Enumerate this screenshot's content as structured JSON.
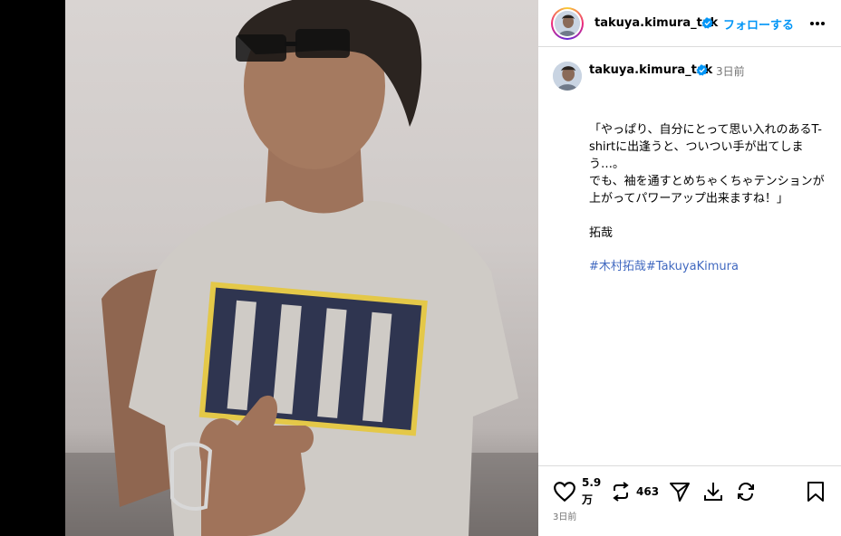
{
  "post": {
    "username": "takuya.kimura_tak",
    "follow_label": "フォローする",
    "posted_ago": "3日前",
    "caption": "「やっぱり、自分にとって思い入れのあるT-shirtに出逢うと、ついつい手が出てしまう…。\nでも、袖を通すとめちゃくちゃテンションが上がってパワーアップ出来ますね！」\n\n拓哉",
    "hashtags": [
      "#木村拓哉",
      "#TakuyaKimura"
    ],
    "likes_line1": "5.9",
    "likes_line2": "万",
    "reposts": "463",
    "bottom_time": "3日前"
  },
  "icons": {
    "verified": "verified-badge-icon",
    "more": "more-options-icon",
    "like": "heart-icon",
    "repost": "repost-icon",
    "share": "send-icon",
    "download": "download-icon",
    "reload": "refresh-icon",
    "save": "bookmark-icon"
  },
  "colors": {
    "accent": "#0095f6",
    "hashtag": "#4169c0",
    "muted": "#737373"
  }
}
